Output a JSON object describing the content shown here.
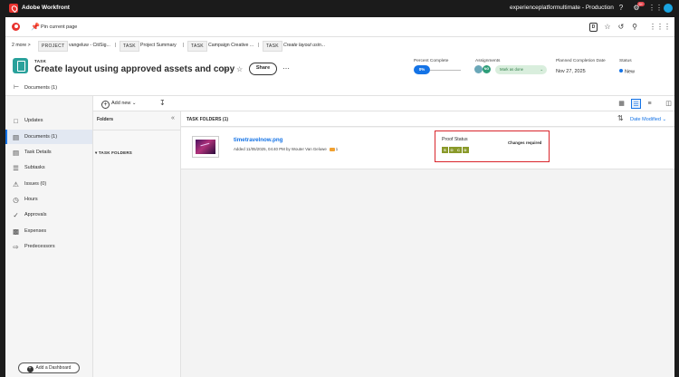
{
  "topbar": {
    "brand": "Adobe Workfront",
    "environment": "experienceplatformultimate - Production",
    "notifications_badge": "9+"
  },
  "pinbar": {
    "pin_label": "Pin current page",
    "box_icon_letter": "D"
  },
  "breadcrumb": {
    "more": "2 more",
    "items": [
      {
        "tag": "PROJECT",
        "label": "vangeluw - CitiSig..."
      },
      {
        "tag": "TASK",
        "label": "Project Summary"
      },
      {
        "tag": "TASK",
        "label": "Campaign Creative ..."
      },
      {
        "tag": "TASK",
        "label": "Create layout usin..."
      }
    ]
  },
  "task": {
    "type_label": "TASK",
    "title": "Create layout using approved assets and copy",
    "share_label": "Share",
    "percent_complete_label": "Percent Complete",
    "percent_complete_value": "0%",
    "percent_complete": 0,
    "assignments_label": "Assignments",
    "assignees": [
      {
        "initials": "",
        "color": "#6aa7b8"
      },
      {
        "initials": "NG",
        "color": "#2d9d78"
      }
    ],
    "mark_done_label": "Mark as done",
    "planned_label": "Planned Completion Date",
    "planned_value": "Nov 27, 2025",
    "status_label": "Status",
    "status_value": "New"
  },
  "documents_header": {
    "label": "Documents (1)"
  },
  "nav": {
    "items": [
      {
        "label": "Updates",
        "icon": "chat-icon"
      },
      {
        "label": "Documents (1)",
        "icon": "document-icon",
        "active": true
      },
      {
        "label": "Task Details",
        "icon": "details-icon"
      },
      {
        "label": "Subtasks",
        "icon": "subtasks-icon"
      },
      {
        "label": "Issues (0)",
        "icon": "issues-icon"
      },
      {
        "label": "Hours",
        "icon": "clock-icon"
      },
      {
        "label": "Approvals",
        "icon": "approval-icon"
      },
      {
        "label": "Expenses",
        "icon": "expenses-icon"
      },
      {
        "label": "Predecessors",
        "icon": "predecessors-icon"
      }
    ],
    "add_dashboard_label": "Add a Dashboard"
  },
  "toolbar": {
    "add_new_label": "Add new"
  },
  "folders": {
    "header": "Folders",
    "task_folders_label": "TASK FOLDERS"
  },
  "content": {
    "header": "TASK FOLDERS (1)",
    "sort_label": "Date Modified"
  },
  "document": {
    "name": "timetravelnow.png",
    "added_text": "Added 11/05/2025, 04:40 PM by Wouter Van Geluwe",
    "comment_count": "1",
    "proof_status_label": "Proof Status",
    "proof_status_value": "Changes required",
    "proof_stages": [
      "S",
      "O",
      "C",
      "D"
    ],
    "proof_color": "#8a9a2a",
    "highlight_color": "#d9252b"
  }
}
